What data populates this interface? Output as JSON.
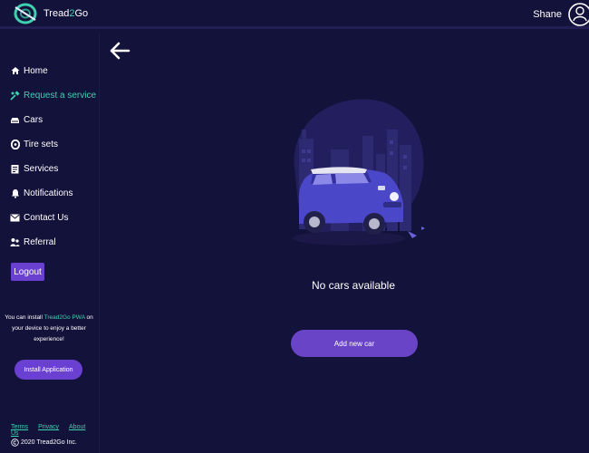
{
  "header": {
    "brand_prefix": "Tread",
    "brand_highlight": "2",
    "brand_suffix": "Go",
    "user_name": "Shane"
  },
  "sidebar": {
    "items": [
      {
        "label": "Home",
        "icon": "home-icon"
      },
      {
        "label": "Request a service",
        "icon": "tools-icon"
      },
      {
        "label": "Cars",
        "icon": "car-icon"
      },
      {
        "label": "Tire sets",
        "icon": "tire-icon"
      },
      {
        "label": "Services",
        "icon": "clipboard-icon"
      },
      {
        "label": "Notifications",
        "icon": "bell-icon"
      },
      {
        "label": "Contact Us",
        "icon": "envelope-icon"
      },
      {
        "label": "Referral",
        "icon": "people-icon"
      }
    ],
    "active_item": "Request a service",
    "logout_label": "Logout",
    "install_text_before": "You can install ",
    "install_text_highlight": "Tread2Go PWA",
    "install_text_after": " on your device to enjoy a better experience!",
    "install_button_label": "Install Application",
    "footer_links": [
      "Terms",
      "Privacy",
      "About Us"
    ],
    "copyright": "2020 Tread2Go Inc."
  },
  "main": {
    "empty_state_text": "No cars available",
    "add_button_label": "Add new car"
  },
  "colors": {
    "background": "#13123a",
    "accent": "#3fd0b0",
    "primary_button": "#6a44c6"
  }
}
